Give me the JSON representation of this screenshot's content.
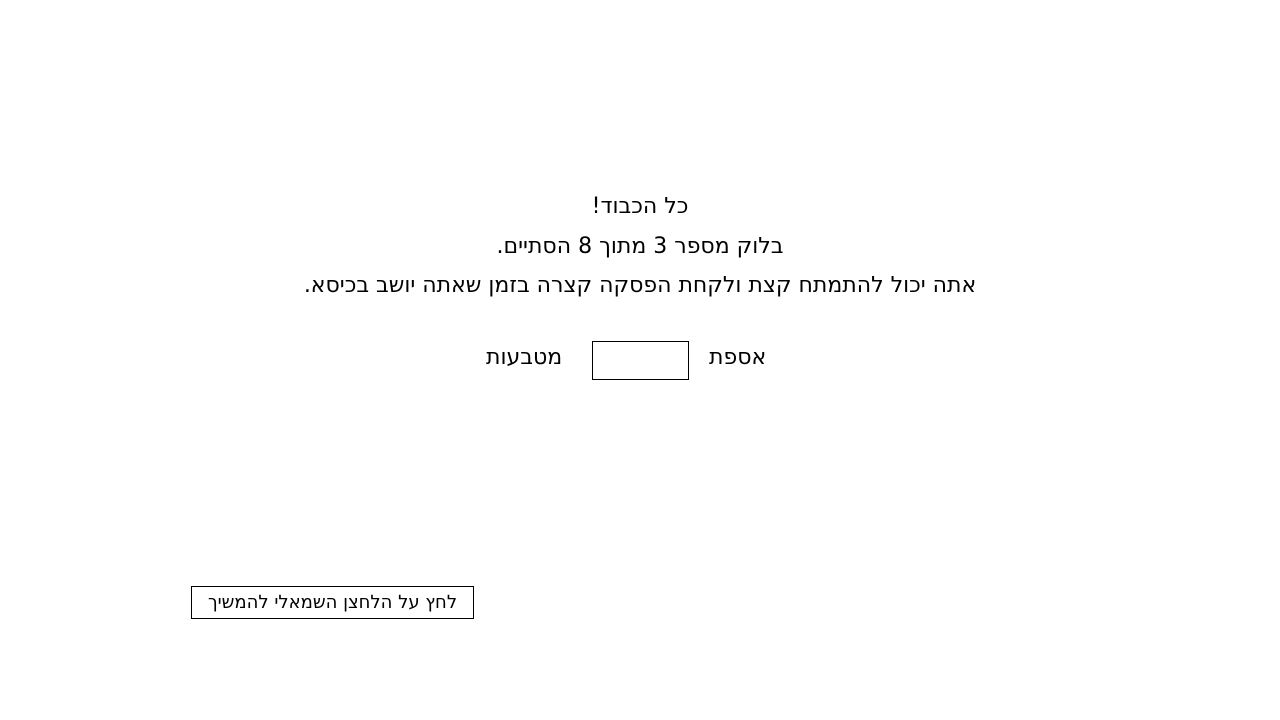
{
  "message": {
    "title": "כל הכבוד!",
    "block_status": "בלוק מספר 3 מתוך 8 הסתיים.",
    "rest_hint": "אתה יכול להתמתח קצת ולקחת הפסקה קצרה בזמן שאתה יושב בכיסא."
  },
  "coins": {
    "prefix": "אספת",
    "count": "",
    "suffix": "מטבעות"
  },
  "continue": {
    "label": "לחץ על הלחצן השמאלי להמשיך"
  }
}
